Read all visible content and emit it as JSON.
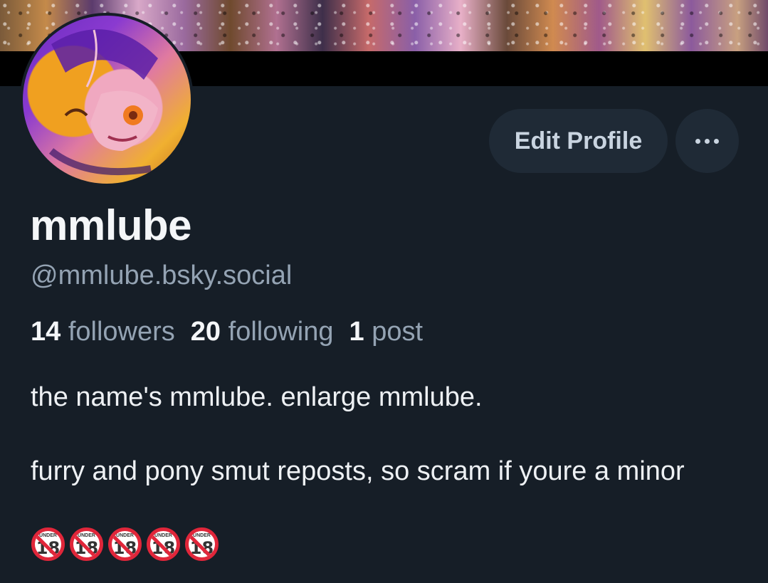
{
  "profile": {
    "display_name": "mmlube",
    "handle": "@mmlube.bsky.social",
    "followers_count": "14",
    "followers_label": "followers",
    "following_count": "20",
    "following_label": "following",
    "posts_count": "1",
    "posts_label": "post",
    "bio": "the name's mmlube. enlarge mmlube.\n\nfurry and pony smut reposts, so scram if youre a minor",
    "bio_emoji": [
      "🔞",
      "🔞",
      "🔞",
      "🔞",
      "🔞"
    ]
  },
  "actions": {
    "edit_profile_label": "Edit Profile",
    "more_icon": "ellipsis-icon"
  },
  "colors": {
    "background": "#161e27",
    "button_bg": "#1f2a36",
    "muted_text": "#94a3b3",
    "primary_text": "#f4f6f8"
  }
}
